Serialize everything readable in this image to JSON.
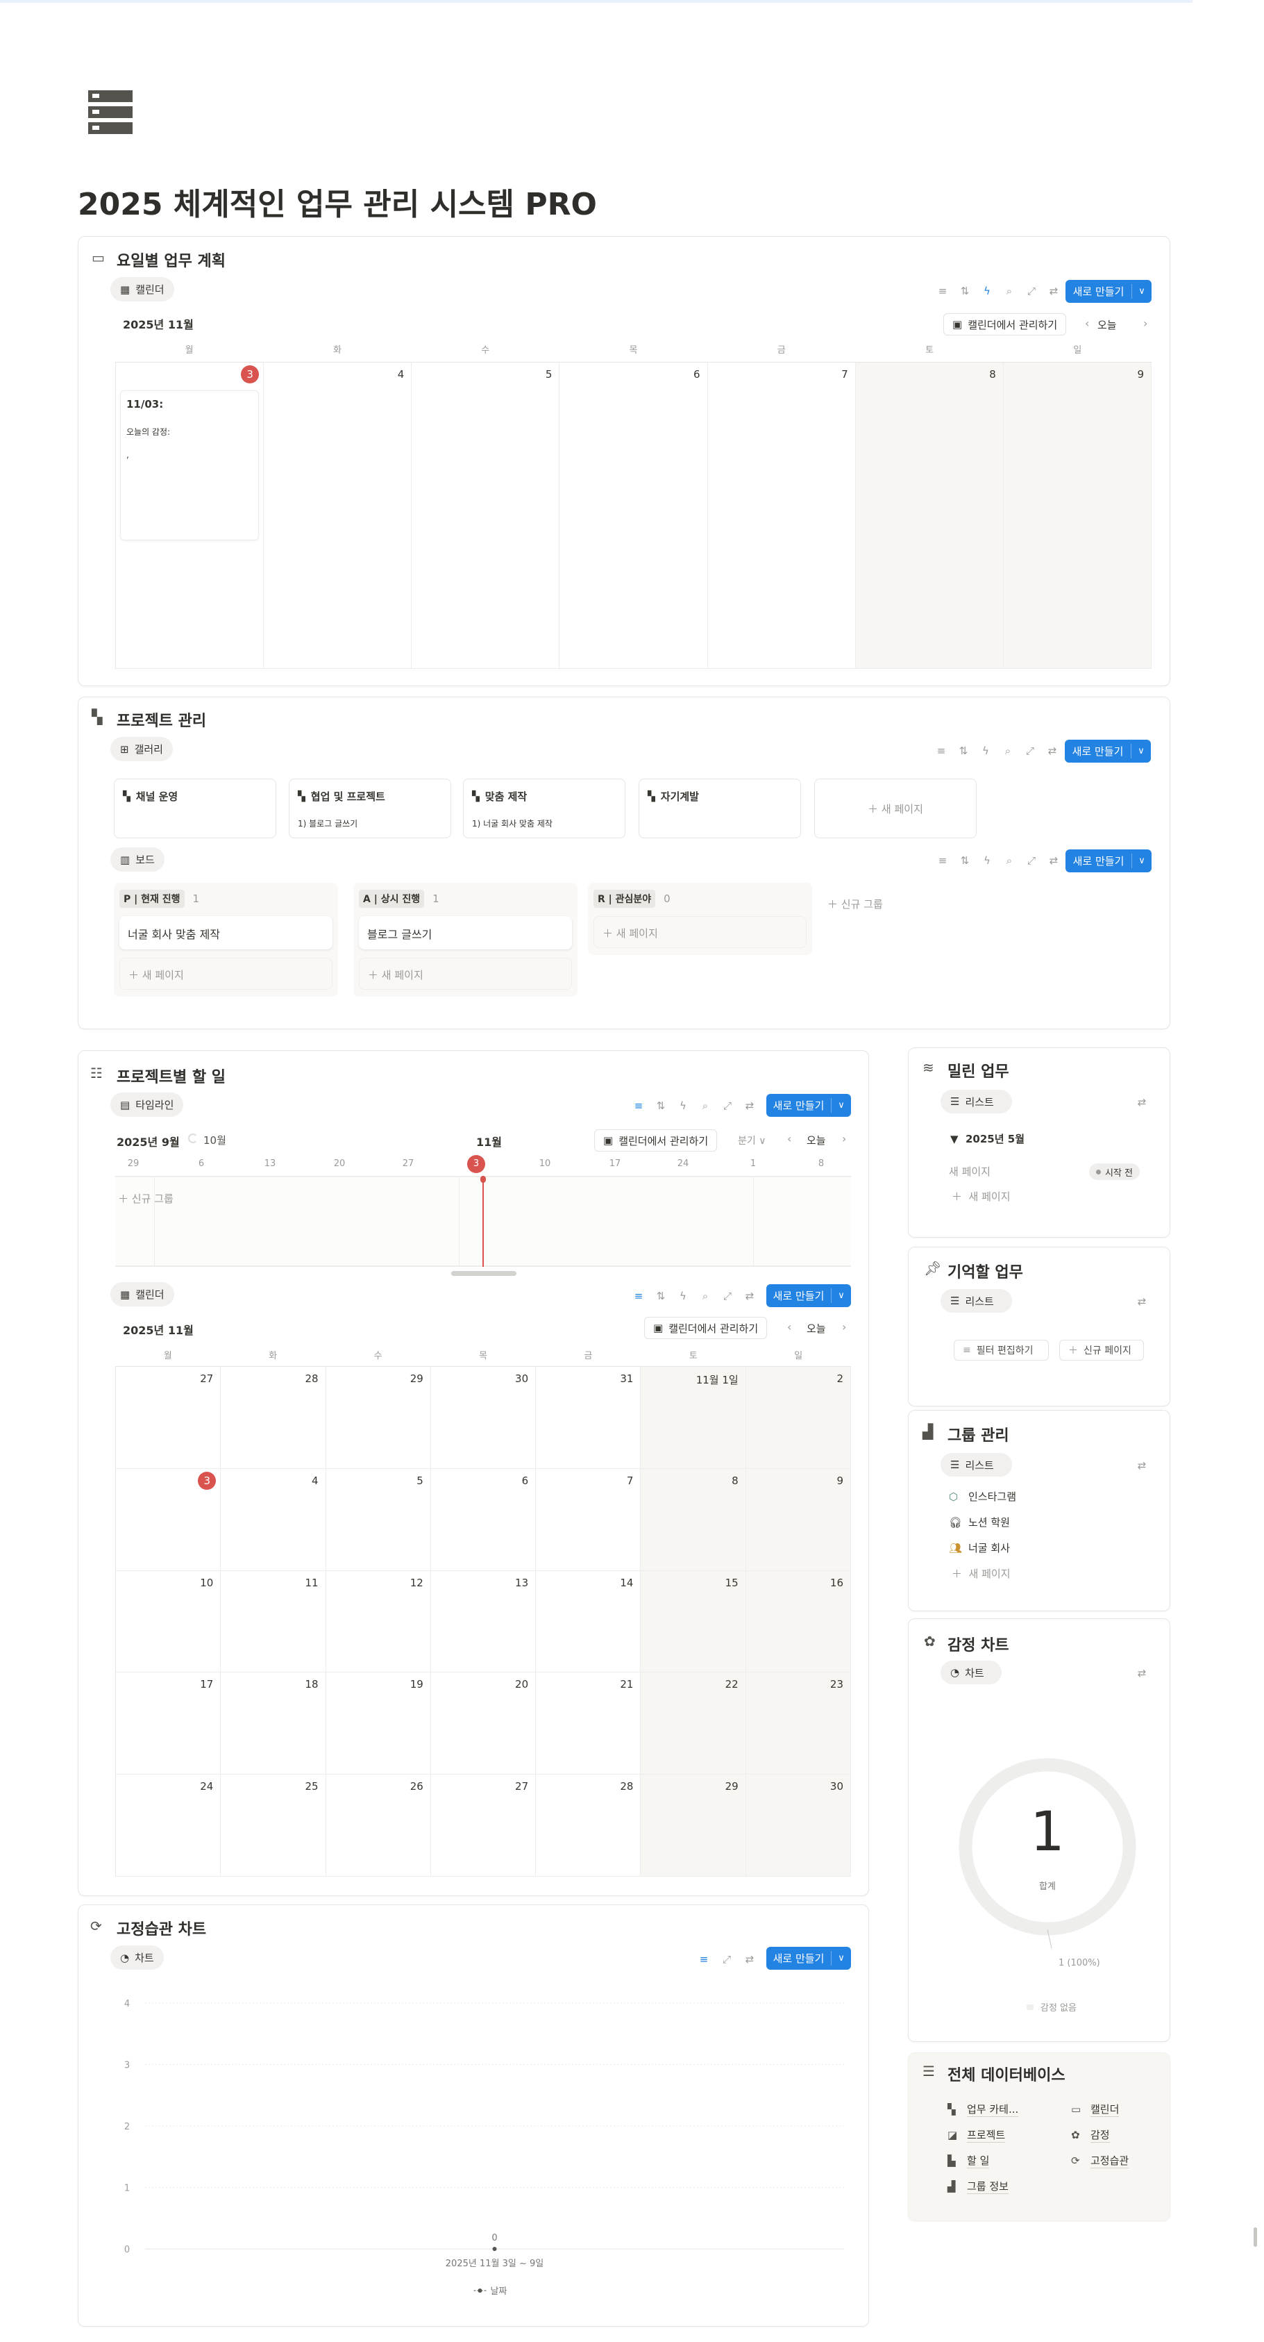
{
  "page": {
    "icon": "database-icon",
    "title": "2025 체계적인 업무 관리 시스템 PRO"
  },
  "common": {
    "new_button": "새로 만들기",
    "manage_calendar": "캘린더에서 관리하기",
    "today": "오늘",
    "new_page": "새 페이지",
    "new_group": "신규 그룹",
    "weekdays": [
      "월",
      "화",
      "수",
      "목",
      "금",
      "토",
      "일"
    ]
  },
  "weekly": {
    "title": "요일별 업무 계획",
    "view": "캘린더",
    "month": "2025년 11월",
    "days": [
      "3",
      "4",
      "5",
      "6",
      "7",
      "8",
      "9"
    ],
    "today_index": 0,
    "event": {
      "title": "11/03:",
      "line1": "오늘의 감정:",
      "line2": ","
    }
  },
  "projects": {
    "title": "프로젝트 관리",
    "gallery_view": "갤러리",
    "gallery": [
      {
        "title": "채널 운영",
        "sub": ""
      },
      {
        "title": "협업 및 프로젝트",
        "sub": "1) 블로그 글쓰기"
      },
      {
        "title": "맞춤 제작",
        "sub": "1) 너굴 회사 맞춤 제작"
      },
      {
        "title": "자기계발",
        "sub": ""
      }
    ],
    "board_view": "보드",
    "board": [
      {
        "tag": "P | 현재 진행",
        "count": "1",
        "cards": [
          "너굴 회사 맞춤 제작"
        ]
      },
      {
        "tag": "A | 상시 진행",
        "count": "1",
        "cards": [
          "블로그 글쓰기"
        ]
      },
      {
        "tag": "R | 관심분야",
        "count": "0",
        "cards": []
      }
    ]
  },
  "tasks": {
    "title": "프로젝트별 할 일",
    "timeline_view": "타임라인",
    "timeline": {
      "month_start": "2025년 9월",
      "month_oct": "10월",
      "month_nov": "11월",
      "period": "분기",
      "dates": [
        "29",
        "6",
        "13",
        "20",
        "27",
        "3",
        "10",
        "17",
        "24",
        "1",
        "8"
      ],
      "today_index": 5
    },
    "calendar_view": "캘린더",
    "calendar": {
      "month": "2025년 11월",
      "weeks": [
        [
          "27",
          "28",
          "29",
          "30",
          "31",
          "11월 1일",
          "2"
        ],
        [
          "3",
          "4",
          "5",
          "6",
          "7",
          "8",
          "9"
        ],
        [
          "10",
          "11",
          "12",
          "13",
          "14",
          "15",
          "16"
        ],
        [
          "17",
          "18",
          "19",
          "20",
          "21",
          "22",
          "23"
        ],
        [
          "24",
          "25",
          "26",
          "27",
          "28",
          "29",
          "30"
        ]
      ],
      "today": "3"
    }
  },
  "habits": {
    "title": "고정습관 차트",
    "view": "차트",
    "chart_data": {
      "type": "line",
      "categories": [
        "2025년 11월 3일 ~ 9일"
      ],
      "series": [
        {
          "name": "날짜",
          "values": [
            0
          ]
        }
      ],
      "ylim": [
        0,
        4
      ],
      "yticks": [
        "0",
        "1",
        "2",
        "3",
        "4"
      ],
      "data_labels": [
        "0"
      ],
      "legend": "bottom",
      "grid": true
    }
  },
  "overdue": {
    "title": "밀린 업무",
    "view": "리스트",
    "group": "2025년 5월",
    "item": "새 페이지",
    "status": "시작 전"
  },
  "remember": {
    "title": "기억할 업무",
    "view": "리스트",
    "edit_filter": "필터 편집하기",
    "new_page": "신규 페이지"
  },
  "groups": {
    "title": "그룹 관리",
    "view": "리스트",
    "items": [
      {
        "label": "인스타그램",
        "icon": "instagram-icon",
        "color": "#4f8a6e"
      },
      {
        "label": "노션 학원",
        "icon": "headphones-icon",
        "color": "#37352f"
      },
      {
        "label": "너굴 회사",
        "icon": "people-icon",
        "color": "#c8922e"
      }
    ]
  },
  "emotion": {
    "title": "감정 차트",
    "view": "차트",
    "chart_data": {
      "type": "pie",
      "total": "1",
      "total_label": "합계",
      "slices": [
        {
          "label": "감정 없음",
          "value": 1,
          "text": "1 (100%)"
        }
      ]
    }
  },
  "databases": {
    "title": "전체 데이터베이스",
    "items": [
      {
        "label": "업무 카테...",
        "icon": "grid-icon"
      },
      {
        "label": "캘린더",
        "icon": "calendar-icon"
      },
      {
        "label": "프로젝트",
        "icon": "project-icon"
      },
      {
        "label": "감정",
        "icon": "flower-icon"
      },
      {
        "label": "할 일",
        "icon": "document-icon"
      },
      {
        "label": "고정습관",
        "icon": "repeat-icon"
      },
      {
        "label": "그룹 정보",
        "icon": "group-icon"
      }
    ]
  },
  "colors": {
    "accent": "#2383e2",
    "today": "#d9534f",
    "weekend": "#f7f6f3"
  }
}
